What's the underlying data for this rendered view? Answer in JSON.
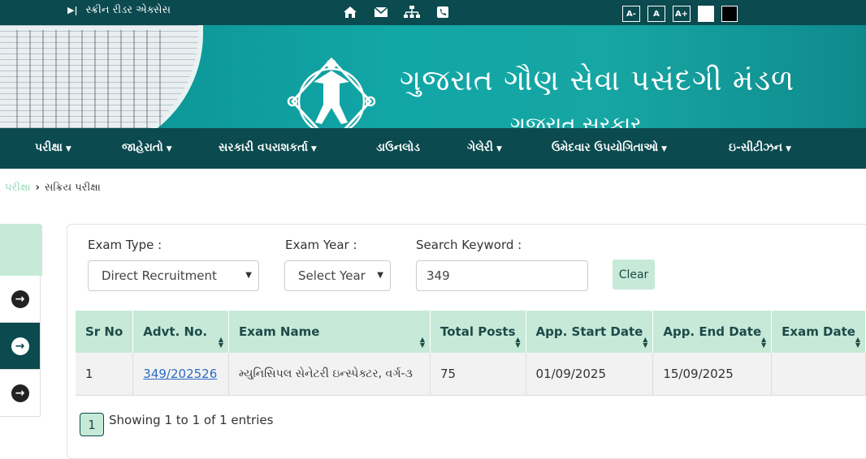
{
  "topbar": {
    "screen_reader": "સ્ક્રીન રીડર એક્સેસ",
    "font_small": "A-",
    "font_normal": "A",
    "font_large": "A+"
  },
  "banner": {
    "title": "ગુજરાત ગૌણ સેવા પસંદગી મંડળ",
    "subtitle": "ગુજરાત સરકાર"
  },
  "nav": {
    "items": [
      "પરીક્ષા",
      "જાહેરાતો",
      "સરકારી વપરાશકર્તા",
      "ડાઉનલોડ",
      "ગેલેરી",
      "ઉમેદવાર ઉપયોગિતાઓ",
      "ઇ-સીટીઝન"
    ]
  },
  "breadcrumb": {
    "parent": "પરીક્ષા",
    "current": "સક્રિય પરીક્ષા"
  },
  "filters": {
    "exam_type_label": "Exam Type :",
    "exam_type_value": "Direct Recruitment",
    "exam_year_label": "Exam Year :",
    "exam_year_value": "Select Year",
    "search_label": "Search Keyword :",
    "search_value": "349",
    "clear_label": "Clear"
  },
  "table": {
    "headers": [
      "Sr No",
      "Advt. No.",
      "Exam Name",
      "Total Posts",
      "App. Start Date",
      "App. End Date",
      "Exam Date"
    ],
    "rows": [
      [
        "1",
        "349/202526",
        "મ્યુનિસિપલ સેનેટરી ઇન્સ્પેક્ટર, વર્ગ-૩",
        "75",
        "01/09/2025",
        "15/09/2025",
        ""
      ]
    ]
  },
  "pagination": {
    "page": "1",
    "info": "Showing 1 to 1 of 1 entries"
  },
  "colors": {
    "primary": "#0b4a4f",
    "accent": "#c6ead7",
    "link": "#2b6cc4"
  }
}
